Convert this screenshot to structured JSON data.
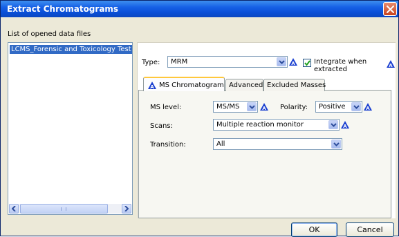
{
  "window": {
    "title": "Extract Chromatograms"
  },
  "files": {
    "label": "List of opened data files",
    "items": [
      "LCMS_Forensic and Toxicology Test"
    ],
    "scroll_grip": "III"
  },
  "type_row": {
    "label": "Type:",
    "value": "MRM",
    "integrate_label": "Integrate when extracted",
    "integrate_checked": true
  },
  "tabs": [
    {
      "label": "MS Chromatogram",
      "active": true
    },
    {
      "label": "Advanced",
      "active": false
    },
    {
      "label": "Excluded Masses",
      "active": false
    }
  ],
  "ms_chrom": {
    "ms_level_label": "MS level:",
    "ms_level_value": "MS/MS",
    "polarity_label": "Polarity:",
    "polarity_value": "Positive",
    "scans_label": "Scans:",
    "scans_value": "Multiple reaction monitor",
    "transition_label": "Transition:",
    "transition_value": "All"
  },
  "buttons": {
    "ok": "OK",
    "cancel": "Cancel"
  },
  "colors": {
    "title_bar": "#0a4fd8",
    "selection": "#316ac5",
    "tab_highlight": "#ffc83c",
    "warning_icon": "#1a3fd0"
  },
  "icons": {
    "close": "close-icon",
    "dropdown": "chevron-down-icon",
    "info": "info-triangle-icon",
    "check": "check-icon",
    "scroll_left": "arrow-left-icon",
    "scroll_right": "arrow-right-icon"
  }
}
